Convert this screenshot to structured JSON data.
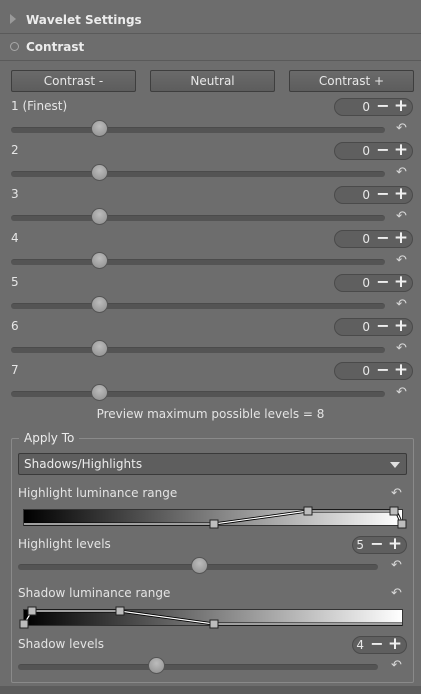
{
  "sections": {
    "wavelet_settings": "Wavelet Settings",
    "contrast": "Contrast"
  },
  "buttons": {
    "contrast_minus": "Contrast -",
    "neutral": "Neutral",
    "contrast_plus": "Contrast +"
  },
  "levels": [
    {
      "label": "1 (Finest)",
      "value": "0"
    },
    {
      "label": "2",
      "value": "0"
    },
    {
      "label": "3",
      "value": "0"
    },
    {
      "label": "4",
      "value": "0"
    },
    {
      "label": "5",
      "value": "0"
    },
    {
      "label": "6",
      "value": "0"
    },
    {
      "label": "7",
      "value": "0"
    }
  ],
  "preview_text": "Preview maximum possible levels = 8",
  "apply_to": {
    "title": "Apply To",
    "combo_value": "Shadows/Highlights",
    "highlight_range_label": "Highlight luminance range",
    "highlight_levels_label": "Highlight levels",
    "highlight_levels_value": "5",
    "shadow_range_label": "Shadow luminance range",
    "shadow_levels_label": "Shadow levels",
    "shadow_levels_value": "4"
  },
  "icons": {
    "spin_minus": "−",
    "spin_plus": "+",
    "reset": "↶"
  }
}
